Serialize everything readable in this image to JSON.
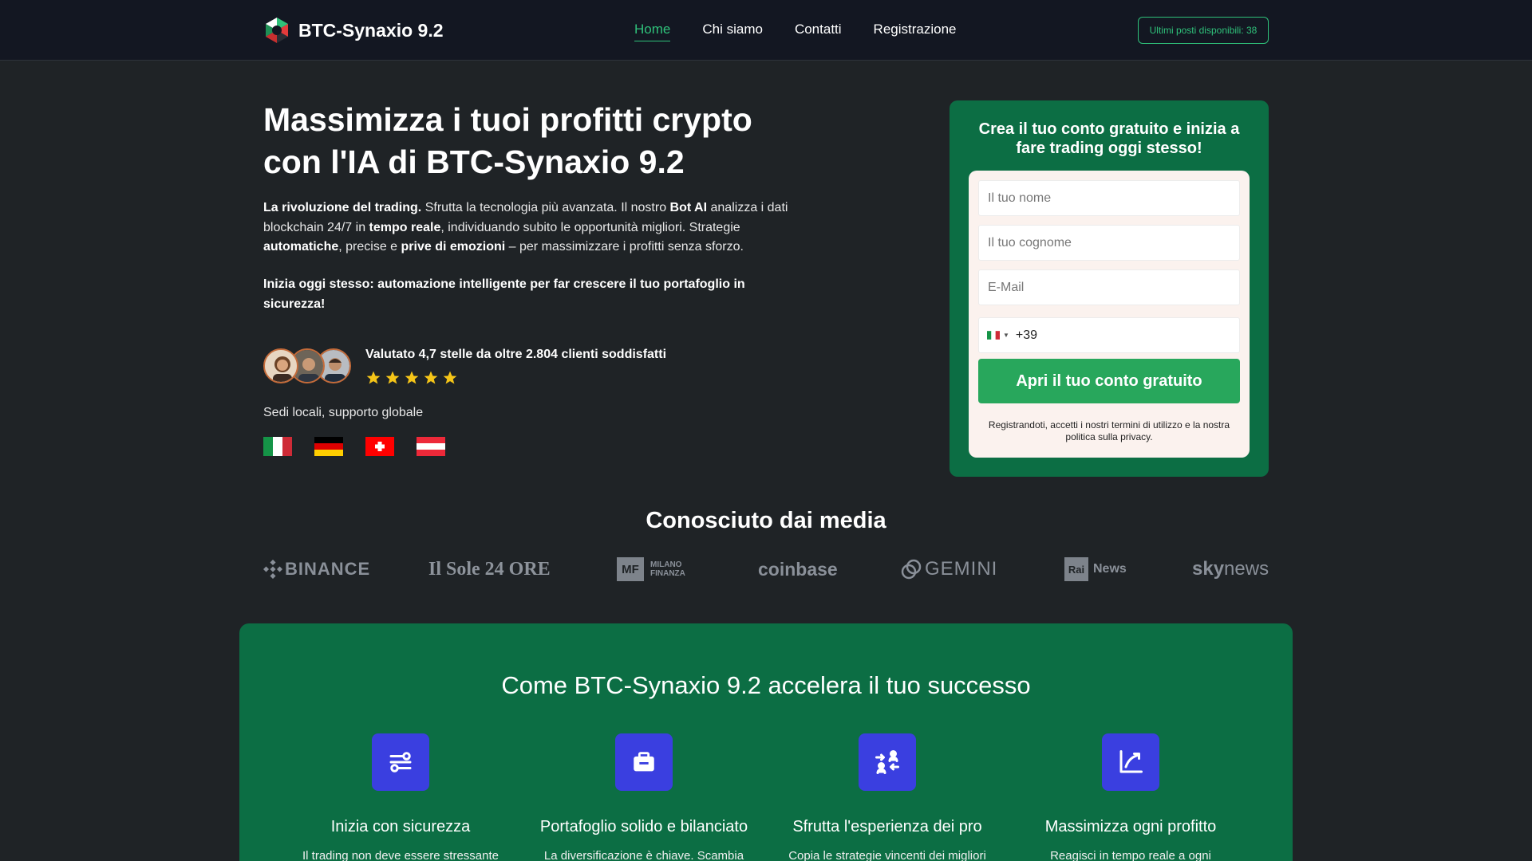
{
  "nav": {
    "brand": "BTC-Synaxio 9.2",
    "links": [
      "Home",
      "Chi siamo",
      "Contatti",
      "Registrazione"
    ],
    "badge": "Ultimi posti disponibili: 38"
  },
  "hero": {
    "title_line1": "Massimizza i tuoi profitti crypto",
    "title_line2": "con l'IA di BTC-Synaxio 9.2",
    "p": {
      "b1": "La rivoluzione del trading.",
      "t1": " Sfrutta la tecnologia più avanzata. Il nostro ",
      "b2": "Bot AI",
      "t2": " analizza i dati blockchain 24/7 in ",
      "b3": "tempo reale",
      "t3": ", individuando subito le opportunità migliori. Strategie ",
      "b4": "automatiche",
      "t4": ", precise e ",
      "b5": "prive di emozioni",
      "t5": " – per massimizzare i profitti senza sforzo."
    },
    "cta": "Inizia oggi stesso: automazione intelligente per far crescere il tuo portafoglio in sicurezza!",
    "rating_text": "Valutato 4,7 stelle da oltre 2.804 clienti soddisfatti",
    "stars": 5,
    "sedi": "Sedi locali, supporto globale",
    "flags": [
      "italy-flag",
      "germany-flag",
      "switzerland-flag",
      "austria-flag"
    ]
  },
  "form": {
    "title": "Crea il tuo conto gratuito e inizia a fare trading oggi stesso!",
    "first_name_placeholder": "Il tuo nome",
    "last_name_placeholder": "Il tuo cognome",
    "email_placeholder": "E-Mail",
    "phone_code": "+39",
    "submit": "Apri il tuo conto gratuito",
    "terms": "Registrandoti, accetti i nostri termini di utilizzo e la nostra politica sulla privacy."
  },
  "media": {
    "title": "Conosciuto dai media",
    "logos": {
      "binance": "BINANCE",
      "sole": "Il Sole 24 ORE",
      "mf_box": "MF",
      "mf_line1": "MILANO",
      "mf_line2": "FINANZA",
      "coinbase": "coinbase",
      "gemini": "GEMINI",
      "rai_box": "Rai",
      "rai_text": "News",
      "sky_bold": "sky",
      "sky_light": "news"
    }
  },
  "features": {
    "title": "Come BTC-Synaxio 9.2 accelera il tuo successo",
    "items": [
      {
        "title": "Inizia con sicurezza",
        "desc": "Il trading non deve essere stressante",
        "icon": "sliders-icon"
      },
      {
        "title": "Portafoglio solido e bilanciato",
        "desc": "La diversificazione è chiave. Scambia",
        "icon": "briefcase-icon"
      },
      {
        "title": "Sfrutta l'esperienza dei pro",
        "desc": "Copia le strategie vincenti dei migliori",
        "icon": "users-swap-icon"
      },
      {
        "title": "Massimizza ogni profitto",
        "desc": "Reagisci in tempo reale a ogni",
        "icon": "chart-growth-icon"
      }
    ]
  },
  "colors": {
    "accent_green": "#2fc17a",
    "card_green": "#0c6e44",
    "button_green": "#28a75c",
    "icon_blue": "#3a3fe0",
    "star_yellow": "#f5c518"
  }
}
